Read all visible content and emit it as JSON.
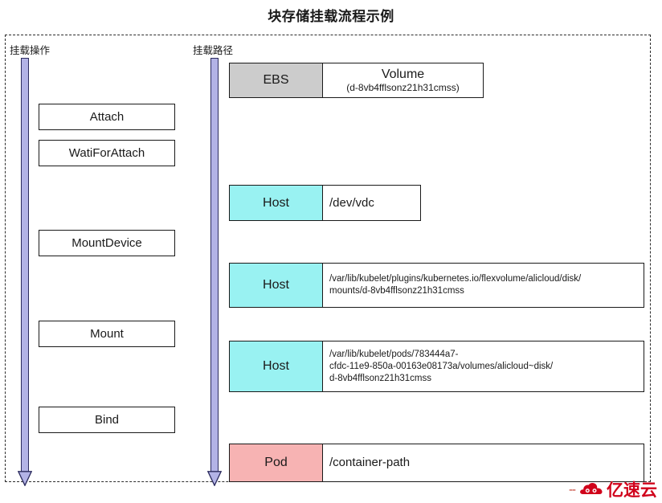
{
  "title": "块存储挂载流程示例",
  "columns": {
    "operation_caption": "挂载操作",
    "path_caption": "挂载路径"
  },
  "colors": {
    "arrow_fill": "#b3b3e6",
    "arrow_stroke": "#2b2b5e",
    "ebs_tag": "#cccccc",
    "host_tag": "#99f2f2",
    "pod_tag": "#f7b3b3",
    "frame_stroke": "#2b2b2b",
    "watermark": "#d0021b"
  },
  "operations": [
    {
      "label": "Attach"
    },
    {
      "label": "WatiForAttach"
    },
    {
      "label": "MountDevice"
    },
    {
      "label": "Mount"
    },
    {
      "label": "Bind"
    }
  ],
  "paths": [
    {
      "tag": "EBS",
      "title": "Volume",
      "subtitle": "(d-8vb4fflsonz21h31cmss)"
    },
    {
      "tag": "Host",
      "value": "/dev/vdc"
    },
    {
      "tag": "Host",
      "value_line1": "/var/lib/kubelet/plugins/kubernetes.io/flexvolume/alicloud/disk/",
      "value_line2": "mounts/d-8vb4fflsonz21h31cmss"
    },
    {
      "tag": "Host",
      "value_line1": "/var/lib/kubelet/pods/783444a7-",
      "value_line2": "cfdc-11e9-850a-00163e08173a/volumes/alicloud~disk/",
      "value_line3": "d-8vb4fflsonz21h31cmss"
    },
    {
      "tag": "Pod",
      "value": "/container-path"
    }
  ],
  "watermark": {
    "dashes": "--",
    "text": "亿速云",
    "logo": "cloud-logo-icon"
  }
}
